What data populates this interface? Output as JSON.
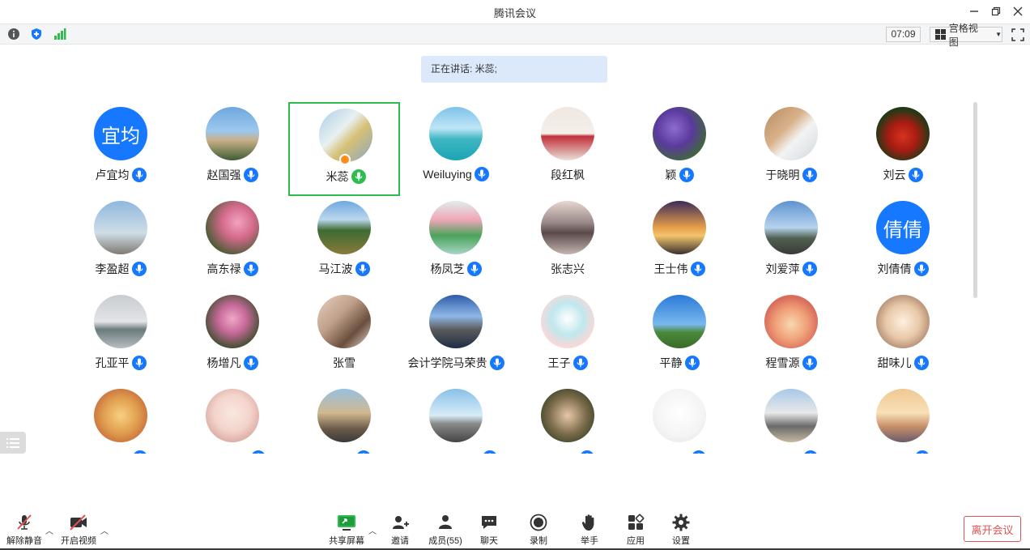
{
  "window": {
    "title": "腾讯会议",
    "minimize_icon": "minimize-icon",
    "restore_icon": "restore-icon",
    "close_icon": "close-icon"
  },
  "toolbar": {
    "info_icon": "info-icon",
    "shield_icon": "shield-icon",
    "signal_icon": "signal-icon",
    "timer": "07:09",
    "view_label": "宫格视图",
    "view_icon": "grid-icon",
    "fullscreen_icon": "fullscreen-icon"
  },
  "speaking_banner": "正在讲话: 米蕊;",
  "participants": [
    {
      "name": "卢宜均",
      "avatar_text": "宜均",
      "mic": "blue"
    },
    {
      "name": "赵国强",
      "mic": "blue"
    },
    {
      "name": "米蕊",
      "mic": "green",
      "active": true
    },
    {
      "name": "Weiluying",
      "mic": "blue"
    },
    {
      "name": "段红枫",
      "mic": "none"
    },
    {
      "name": "颖",
      "mic": "blue"
    },
    {
      "name": "于晓明",
      "mic": "blue"
    },
    {
      "name": "刘云",
      "mic": "blue"
    },
    {
      "name": "李盈超",
      "mic": "blue"
    },
    {
      "name": "高东禄",
      "mic": "blue"
    },
    {
      "name": "马江波",
      "mic": "blue"
    },
    {
      "name": "杨凤芝",
      "mic": "blue"
    },
    {
      "name": "张志兴",
      "mic": "none"
    },
    {
      "name": "王士伟",
      "mic": "blue"
    },
    {
      "name": "刘爱萍",
      "mic": "blue"
    },
    {
      "name": "刘倩倩",
      "avatar_text": "倩倩",
      "mic": "blue"
    },
    {
      "name": "孔亚平",
      "mic": "blue"
    },
    {
      "name": "杨增凡",
      "mic": "blue"
    },
    {
      "name": "张雪",
      "mic": "none"
    },
    {
      "name": "会计学院马荣贵",
      "mic": "blue"
    },
    {
      "name": "王子",
      "mic": "blue"
    },
    {
      "name": "平静",
      "mic": "blue"
    },
    {
      "name": "程雪源",
      "mic": "blue"
    },
    {
      "name": "甜味儿",
      "mic": "blue"
    }
  ],
  "bottom_bar": {
    "unmute": "解除静音",
    "start_video": "开启视频",
    "share_screen": "共享屏幕",
    "invite": "邀请",
    "members": "成员(55)",
    "chat": "聊天",
    "record": "录制",
    "raise_hand": "举手",
    "apps": "应用",
    "settings": "设置",
    "leave": "离开会议"
  },
  "colors": {
    "accent": "#1677ff",
    "active_border": "#2dbd4e",
    "leave": "#e05353",
    "banner": "#dce9fb"
  }
}
